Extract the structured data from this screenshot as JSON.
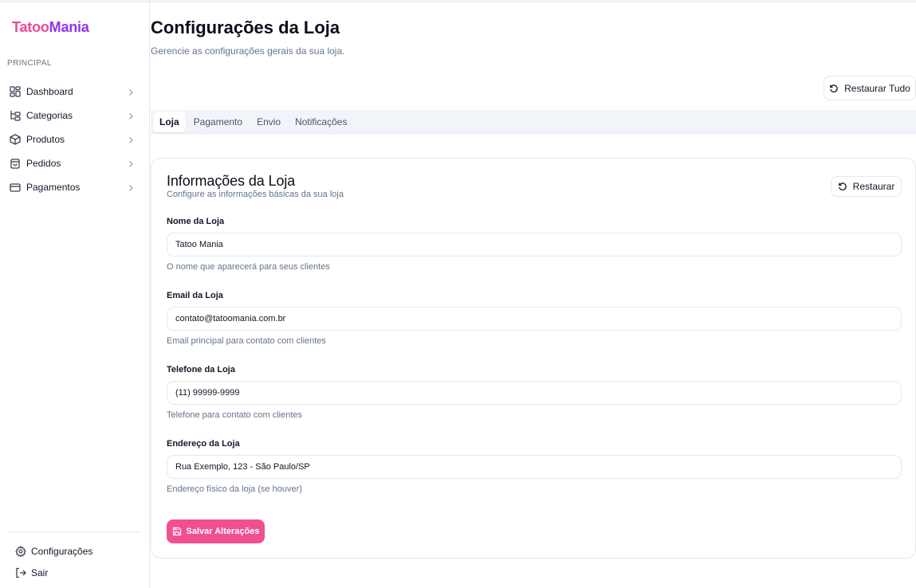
{
  "brand": {
    "part1": "Tatoo",
    "part2": "Mania",
    "color1": "#ec4899",
    "color2": "#9333ea"
  },
  "sidebar": {
    "section_label": "PRINCIPAL",
    "items": [
      {
        "label": "Dashboard",
        "icon": "dashboard-grid-icon"
      },
      {
        "label": "Categorias",
        "icon": "category-tree-icon"
      },
      {
        "label": "Produtos",
        "icon": "box-icon"
      },
      {
        "label": "Pedidos",
        "icon": "shopping-bag-icon"
      },
      {
        "label": "Pagamentos",
        "icon": "credit-card-icon"
      }
    ],
    "settings_label": "Configurações",
    "logout_label": "Sair"
  },
  "header": {
    "title": "Configurações da Loja",
    "subtitle": "Gerencie as configurações gerais da sua loja.",
    "restore_all_label": "Restaurar Tudo"
  },
  "tabs": [
    {
      "label": "Loja",
      "active": true
    },
    {
      "label": "Pagamento",
      "active": false
    },
    {
      "label": "Envio",
      "active": false
    },
    {
      "label": "Notificações",
      "active": false
    }
  ],
  "card": {
    "title": "Informações da Loja",
    "subtitle": "Configure as informações básicas da sua loja",
    "restore_label": "Restaurar",
    "fields": [
      {
        "label": "Nome da Loja",
        "value": "Tatoo Mania",
        "help": "O nome que aparecerá para seus clientes"
      },
      {
        "label": "Email da Loja",
        "value": "contato@tatoomania.com.br",
        "help": "Email principal para contato com clientes"
      },
      {
        "label": "Telefone da Loja",
        "value": "(11) 99999-9999",
        "help": "Telefone para contato com clientes"
      },
      {
        "label": "Endereço da Loja",
        "value": "Rua Exemplo, 123 - São Paulo/SP",
        "help": "Endereço físico da loja (se houver)"
      }
    ],
    "save_label": "Salvar Alterações"
  },
  "colors": {
    "accent": "#f0508f",
    "muted_text": "#64748b",
    "border": "#e5e7eb"
  }
}
